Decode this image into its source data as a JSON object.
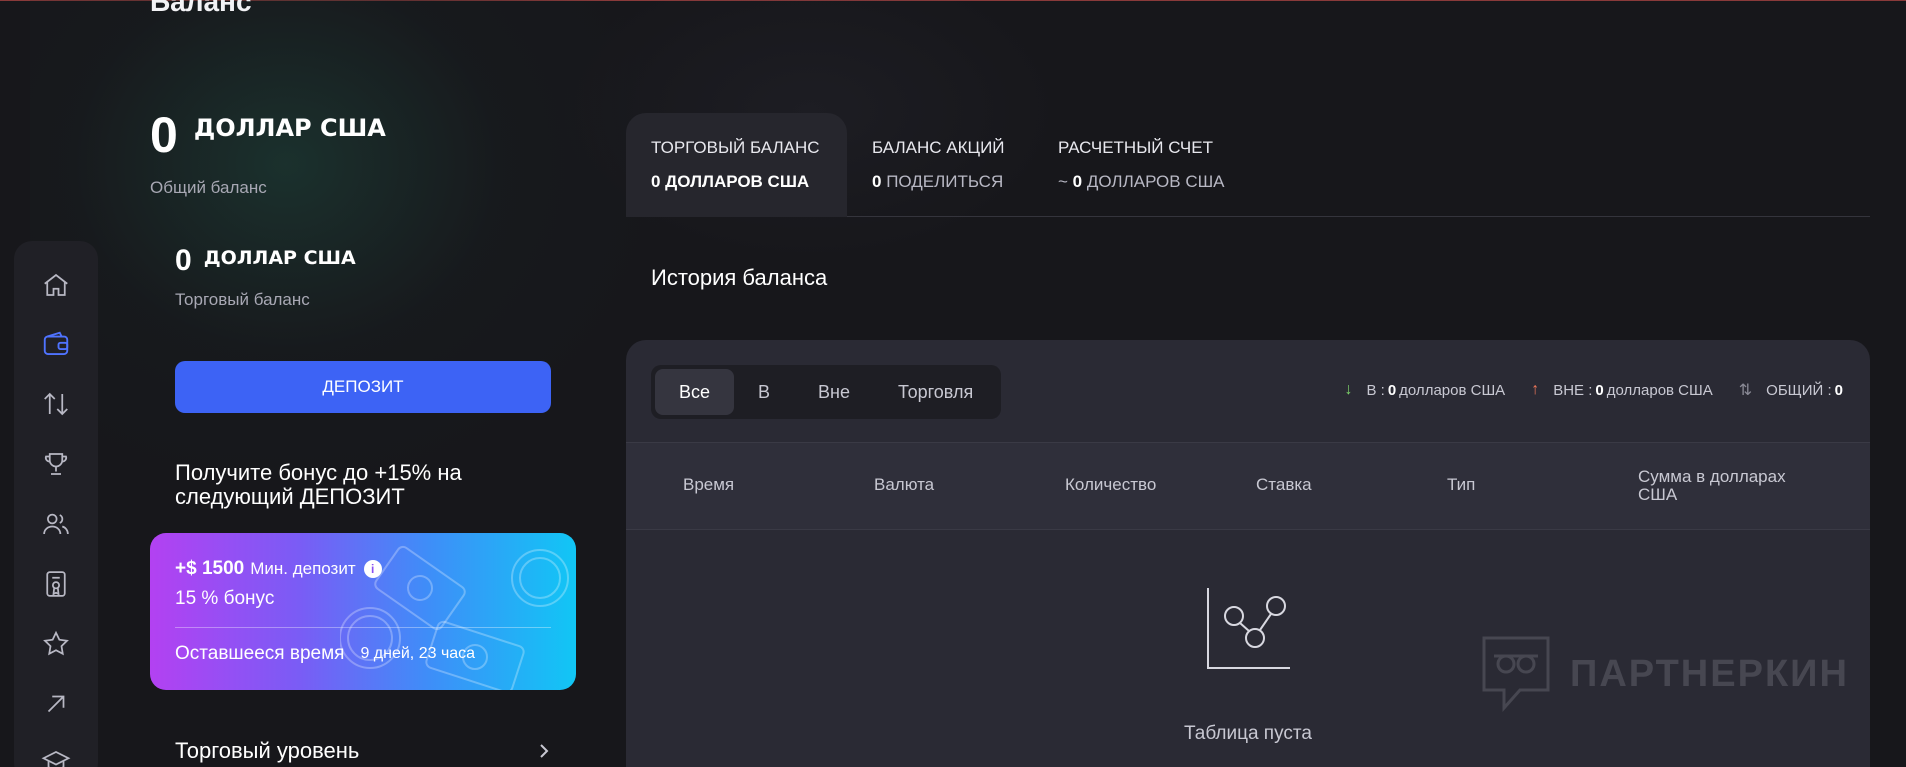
{
  "page": {
    "title": "Баланс"
  },
  "sidebar": {
    "items": [
      {
        "icon": "home-icon"
      },
      {
        "icon": "wallet-icon",
        "active": true
      },
      {
        "icon": "transfer-icon"
      },
      {
        "icon": "trophy-icon"
      },
      {
        "icon": "users-icon"
      },
      {
        "icon": "certificate-icon"
      },
      {
        "icon": "star-icon"
      },
      {
        "icon": "arrow-up-right-icon"
      },
      {
        "icon": "graduation-cap-icon"
      }
    ]
  },
  "balance": {
    "total_value": "0",
    "total_currency": "ДОЛЛАР США",
    "total_label": "Общий баланс",
    "trading_value": "0",
    "trading_currency": "ДОЛЛАР США",
    "trading_label": "Торговый баланс",
    "deposit_button": "ДЕПОЗИТ"
  },
  "bonus": {
    "title": "Получите бонус до +15% на следующий ДЕПОЗИТ",
    "amount": "+$ 1500",
    "min_deposit_label": "Мин. депозит",
    "percent_text": "15 % бонус",
    "time_label": "Оставшееся время",
    "time_value": "9 дней, 23 часа"
  },
  "trade_level": {
    "label": "Торговый уровень"
  },
  "tabs": [
    {
      "title": "ТОРГОВЫЙ БАЛАНС",
      "value": "0 ДОЛЛАРОВ США",
      "active": true
    },
    {
      "title": "БАЛАНС АКЦИЙ",
      "value_num": "0",
      "value_text": "ПОДЕЛИТЬСЯ"
    },
    {
      "title": "РАСЧЕТНЫЙ СЧЕТ",
      "value_prefix": "~",
      "value_num": "0",
      "value_text": "ДОЛЛАРОВ США"
    }
  ],
  "history": {
    "title": "История баланса",
    "filters": [
      "Все",
      "В",
      "Вне",
      "Торговля"
    ],
    "active_filter": "Все",
    "summary": {
      "in_label": "В :",
      "in_value": "0",
      "in_unit": "долларов США",
      "out_label": "ВНЕ :",
      "out_value": "0",
      "out_unit": "долларов США",
      "total_label": "ОБЩИЙ :",
      "total_value": "0"
    },
    "columns": [
      "Время",
      "Валюта",
      "Количество",
      "Ставка",
      "Тип",
      "Сумма в долларах США"
    ],
    "empty_text": "Таблица пуста"
  },
  "watermark": {
    "text": "ПАРТНЕРКИН"
  },
  "colors": {
    "accent": "#3d63f5",
    "in_arrow": "#7dd36a",
    "out_arrow": "#f0785a",
    "active_icon": "#4f73ff"
  }
}
